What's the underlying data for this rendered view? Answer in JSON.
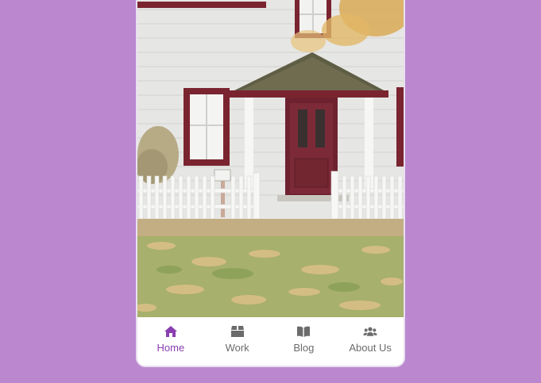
{
  "nav": {
    "items": [
      {
        "label": "Home",
        "icon": "home-icon",
        "active": true
      },
      {
        "label": "Work",
        "icon": "box-icon",
        "active": false
      },
      {
        "label": "Blog",
        "icon": "book-icon",
        "active": false
      },
      {
        "label": "About Us",
        "icon": "users-icon",
        "active": false
      }
    ]
  },
  "colors": {
    "background": "#bb88d0",
    "active": "#8a3fb0",
    "inactive": "#6b6b6b"
  }
}
